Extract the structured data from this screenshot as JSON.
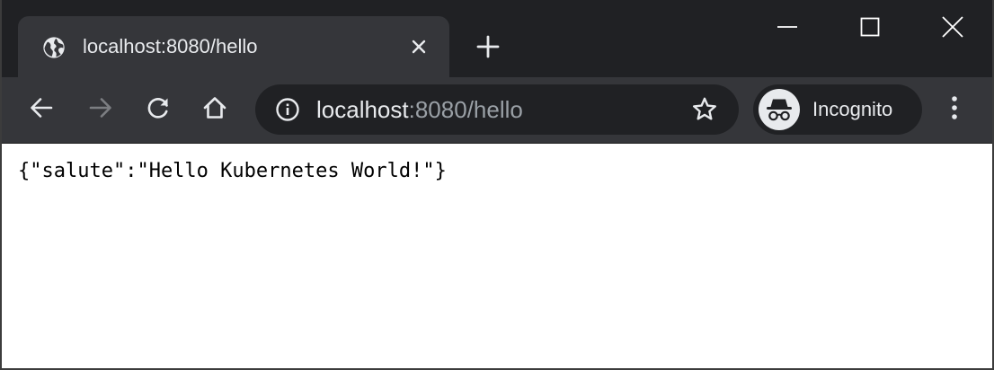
{
  "browser": {
    "tab": {
      "title": "localhost:8080/hello",
      "favicon_icon": "globe-icon",
      "close_icon": "close-icon"
    },
    "new_tab_icon": "plus-icon",
    "window_controls": {
      "minimize_icon": "minimize-icon",
      "maximize_icon": "maximize-icon",
      "close_icon": "close-icon"
    },
    "toolbar": {
      "back_icon": "arrow-left-icon",
      "forward_icon": "arrow-right-icon",
      "reload_icon": "reload-icon",
      "home_icon": "home-icon",
      "menu_icon": "more-vertical-icon"
    },
    "omnibox": {
      "info_icon": "info-icon",
      "url_host": "localhost",
      "url_rest": ":8080/hello",
      "bookmark_icon": "star-icon"
    },
    "profile": {
      "label": "Incognito",
      "avatar_icon": "incognito-icon"
    }
  },
  "page": {
    "body_text": "{\"salute\":\"Hello Kubernetes World!\"}"
  },
  "colors": {
    "titlebar": "#202124",
    "toolbar": "#35363a",
    "omnibox": "#202124",
    "text_light": "#e8eaed",
    "text_dim": "#9aa0a6",
    "forward_disabled": "#7c7e82"
  }
}
